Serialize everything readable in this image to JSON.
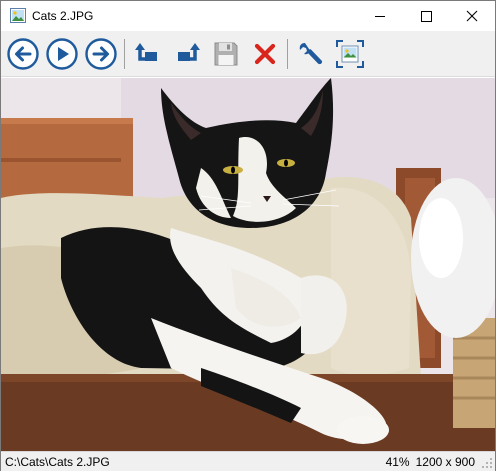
{
  "window": {
    "title": "Cats 2.JPG",
    "icons": {
      "app": "image-file-icon",
      "minimize": "minimize-icon",
      "maximize": "maximize-icon",
      "close": "close-icon"
    }
  },
  "toolbar": {
    "buttons": [
      {
        "id": "previous",
        "icon": "arrow-left-circle-icon"
      },
      {
        "id": "slideshow",
        "icon": "play-circle-icon"
      },
      {
        "id": "next",
        "icon": "arrow-right-circle-icon"
      },
      {
        "id": "rotate-left",
        "icon": "rotate-left-icon"
      },
      {
        "id": "rotate-right",
        "icon": "rotate-right-icon"
      },
      {
        "id": "save",
        "icon": "floppy-disk-icon",
        "enabled": false
      },
      {
        "id": "delete",
        "icon": "red-x-icon"
      },
      {
        "id": "settings",
        "icon": "wrench-icon"
      },
      {
        "id": "fit-to-window",
        "icon": "fit-image-icon"
      }
    ],
    "colors": {
      "accent_blue": "#1e5a9c",
      "delete_red": "#d9261c",
      "disabled_gray": "#9a9a9a"
    }
  },
  "image": {
    "subject": "black-and-white cat lying in a fleece pet bed",
    "icon": "photo-icon"
  },
  "statusbar": {
    "path": "C:\\Cats\\Cats 2.JPG",
    "zoom": "41%",
    "dimensions": "1200 x 900"
  }
}
